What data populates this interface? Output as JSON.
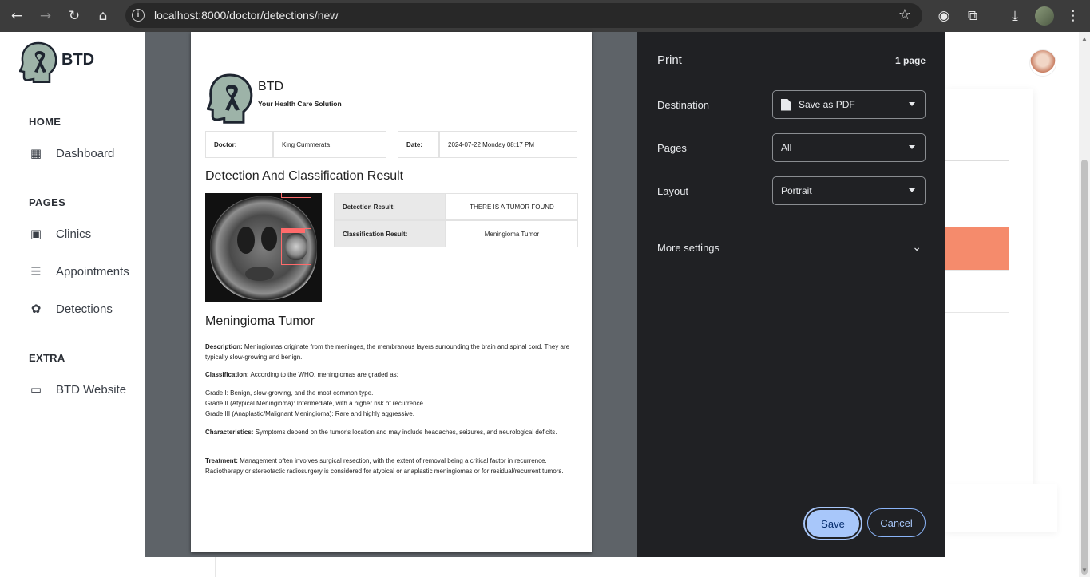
{
  "browser": {
    "url": "localhost:8000/doctor/detections/new"
  },
  "app": {
    "brand": "BTD",
    "sidebar": {
      "sections": [
        {
          "title": "HOME",
          "items": [
            {
              "label": "Dashboard",
              "icon": "dashboard-icon"
            }
          ]
        },
        {
          "title": "PAGES",
          "items": [
            {
              "label": "Clinics",
              "icon": "clinic-icon"
            },
            {
              "label": "Appointments",
              "icon": "list-icon"
            },
            {
              "label": "Detections",
              "icon": "brain-icon"
            }
          ]
        },
        {
          "title": "EXTRA",
          "items": [
            {
              "label": "BTD Website",
              "icon": "browser-window-icon"
            }
          ]
        }
      ]
    },
    "accent_color": "#f58b6c"
  },
  "report": {
    "brand": "BTD",
    "tagline": "Your Health Care Solution",
    "doctor_label": "Doctor:",
    "doctor_value": "King Cummerata",
    "date_label": "Date:",
    "date_value": "2024-07-22 Monday 08:17 PM",
    "result_heading": "Detection And Classification Result",
    "detection_label": "Detection Result:",
    "detection_value": "THERE IS A TUMOR FOUND",
    "classification_label": "Classification Result:",
    "classification_value": "Meningioma Tumor",
    "tumor_heading": "Meningioma Tumor",
    "description_label": "Description:",
    "description_text": " Meningiomas originate from the meninges, the membranous layers surrounding the brain and spinal cord. They are typically slow-growing and benign.",
    "classification_title": "Classification:",
    "classification_text": " According to the WHO, meningiomas are graded as:",
    "grade_1": "Grade I: Benign, slow-growing, and the most common type.",
    "grade_2": "Grade II (Atypical Meningioma): Intermediate, with a higher risk of recurrence.",
    "grade_3": "Grade III (Anaplastic/Malignant Meningioma): Rare and highly aggressive.",
    "characteristics_label": "Characteristics:",
    "characteristics_text": " Symptoms depend on the tumor's location and may include headaches, seizures, and neurological deficits.",
    "treatment_label": "Treatment:",
    "treatment_text": " Management often involves surgical resection, with the extent of removal being a critical factor in recurrence. Radiotherapy or stereotactic radiosurgery is considered for atypical or anaplastic meningiomas or for residual/recurrent tumors."
  },
  "print": {
    "title": "Print",
    "page_count": "1 page",
    "destination_label": "Destination",
    "destination_value": "Save as PDF",
    "pages_label": "Pages",
    "pages_value": "All",
    "layout_label": "Layout",
    "layout_value": "Portrait",
    "more_settings": "More settings",
    "save_label": "Save",
    "cancel_label": "Cancel",
    "save_color": "#a8c7fa"
  }
}
